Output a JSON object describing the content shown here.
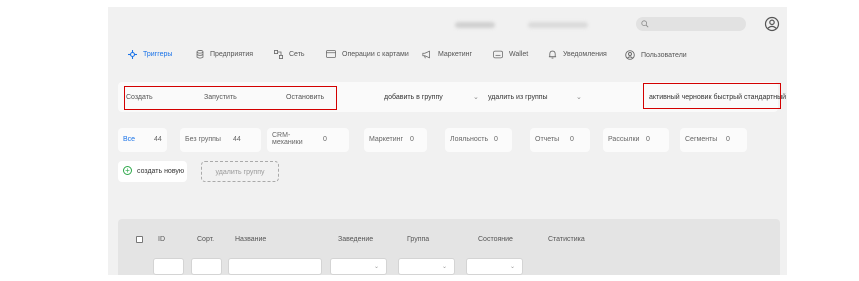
{
  "nav": {
    "items": [
      {
        "label": "Триггеры",
        "icon": "trigger-icon"
      },
      {
        "label": "Предприятия",
        "icon": "database-icon"
      },
      {
        "label": "Сеть",
        "icon": "network-icon"
      },
      {
        "label": "Операции с картами",
        "icon": "card-icon"
      },
      {
        "label": "Маркетинг",
        "icon": "megaphone-icon"
      },
      {
        "label": "Wallet",
        "icon": "wallet-icon"
      },
      {
        "label": "Уведомления",
        "icon": "bell-icon"
      },
      {
        "label": "Пользователи",
        "icon": "users-icon"
      }
    ],
    "active_index": 0
  },
  "actions": {
    "create": "Создать",
    "run": "Запустить",
    "stop": "Остановить",
    "add_to_group": "добавить в группу",
    "remove_from_group": "удалить из группы",
    "status_filter": "активный черновик быстрый стандартный"
  },
  "groups": [
    {
      "label": "Все",
      "count": "44"
    },
    {
      "label": "Без группы",
      "count": "44"
    },
    {
      "label": "CRM-механики",
      "count": "0"
    },
    {
      "label": "Маркетинг",
      "count": "0"
    },
    {
      "label": "Лояльность",
      "count": "0"
    },
    {
      "label": "Отчеты",
      "count": "0"
    },
    {
      "label": "Рассылки",
      "count": "0"
    },
    {
      "label": "Сегменты",
      "count": "0"
    }
  ],
  "group_actions": {
    "create_new": "создать новую",
    "delete_group": "удалить группу"
  },
  "table": {
    "columns": [
      "ID",
      "Сорт.",
      "Название",
      "Заведение",
      "Группа",
      "Состояние",
      "Статистика"
    ]
  },
  "colors": {
    "accent": "#1a73e8",
    "highlight": "#d30000",
    "success": "#2ea84a"
  }
}
